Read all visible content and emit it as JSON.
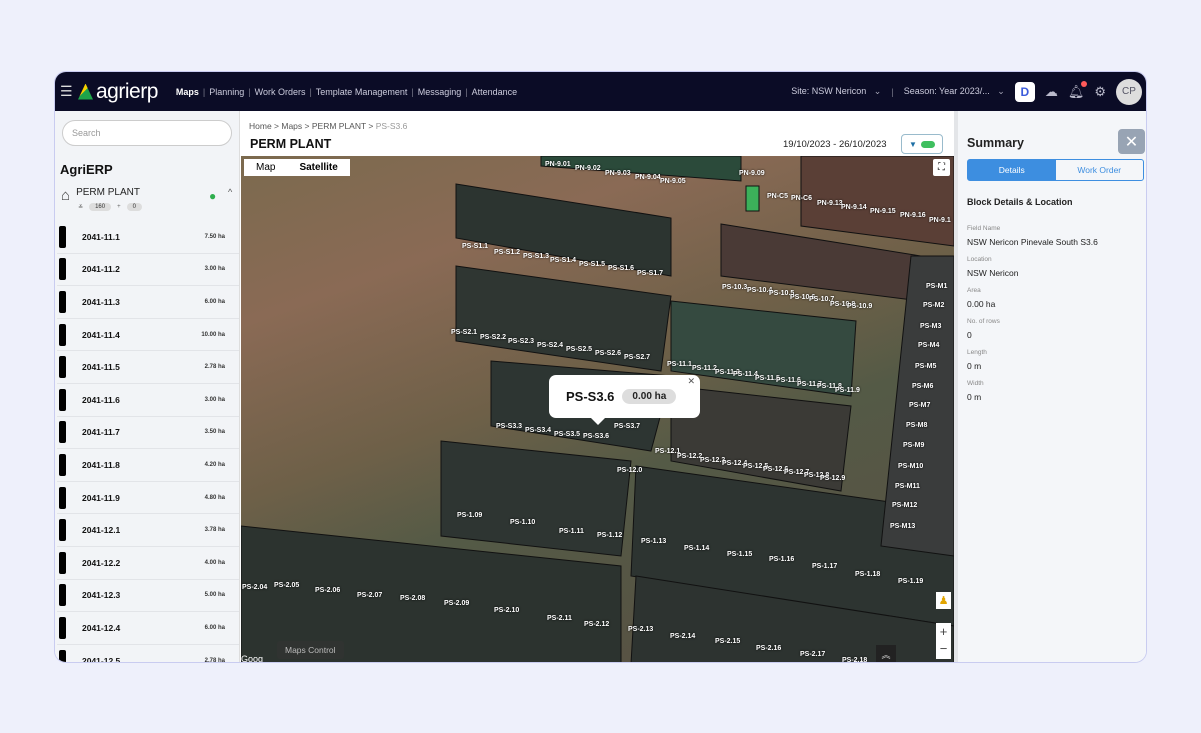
{
  "topbar": {
    "logo": "agrierp",
    "nav": [
      "Maps",
      "Planning",
      "Work Orders",
      "Template Management",
      "Messaging",
      "Attendance"
    ],
    "active": "Maps",
    "site": "Site: NSW Nericon",
    "season": "Season: Year 2023/...",
    "avatar": "CP"
  },
  "sidebar": {
    "search_placeholder": "Search",
    "org": "AgriERP",
    "farm": {
      "name": "PERM PLANT",
      "blocks": "160",
      "other": "0"
    },
    "items": [
      {
        "name": "2041-11.1",
        "area": "7.50 ha"
      },
      {
        "name": "2041-11.2",
        "area": "3.00 ha"
      },
      {
        "name": "2041-11.3",
        "area": "6.00 ha"
      },
      {
        "name": "2041-11.4",
        "area": "10.00 ha"
      },
      {
        "name": "2041-11.5",
        "area": "2.78 ha"
      },
      {
        "name": "2041-11.6",
        "area": "3.00 ha"
      },
      {
        "name": "2041-11.7",
        "area": "3.50 ha"
      },
      {
        "name": "2041-11.8",
        "area": "4.20 ha"
      },
      {
        "name": "2041-11.9",
        "area": "4.80 ha"
      },
      {
        "name": "2041-12.1",
        "area": "3.78 ha"
      },
      {
        "name": "2041-12.2",
        "area": "4.00 ha"
      },
      {
        "name": "2041-12.3",
        "area": "5.00 ha"
      },
      {
        "name": "2041-12.4",
        "area": "6.00 ha"
      },
      {
        "name": "2041-12.5",
        "area": "2.78 ha"
      }
    ]
  },
  "header": {
    "breadcrumb": [
      "Home",
      "Maps",
      "PERM PLANT",
      "PS-S3.6"
    ],
    "title": "PERM PLANT",
    "date_range": "19/10/2023 - 26/10/2023"
  },
  "map": {
    "types": [
      "Map",
      "Satellite"
    ],
    "active_type": "Satellite",
    "controls_label": "Maps Control",
    "attribution": "Goog",
    "popup": {
      "name": "PS-S3.6",
      "area": "0.00 ha"
    },
    "labels": [
      "PN-9.01",
      "PN-9.02",
      "PN-9.03",
      "PN-9.04",
      "PN-9.05",
      "PN-9.09",
      "PN-C5",
      "PN-C6",
      "PN-9.13",
      "PN-9.14",
      "PN-9.15",
      "PN-9.16",
      "PN-9.1",
      "PS-S1.1",
      "PS-S1.2",
      "PS-S1.3",
      "PS-S1.4",
      "PS-S1.5",
      "PS-S1.6",
      "PS-S1.7",
      "PS-S2.1",
      "PS-S2.2",
      "PS-S2.3",
      "PS-S2.4",
      "PS-S2.5",
      "PS-S2.6",
      "PS-S2.7",
      "PS-S3.3",
      "PS-S3.4",
      "PS-S3.5",
      "PS-S3.6",
      "PS-S3.7",
      "PS-10.3",
      "PS-10.4",
      "PS-10.5",
      "PS-10.6",
      "PS-10.7",
      "PS-10.8",
      "PS-10.9",
      "PS-11.1",
      "PS-11.2",
      "PS-11.3",
      "PS-11.4",
      "PS-11.5",
      "PS-11.6",
      "PS-11.7",
      "PS-11.8",
      "PS-11.9",
      "PS-M1",
      "PS-M2",
      "PS-M3",
      "PS-M4",
      "PS-M5",
      "PS-M6",
      "PS-M7",
      "PS-M8",
      "PS-M9",
      "PS-M10",
      "PS-M11",
      "PS-M12",
      "PS-M13",
      "PS-12.0",
      "PS-12.1",
      "PS-12.2",
      "PS-12.3",
      "PS-12.4",
      "PS-12.5",
      "PS-12.6",
      "PS-12.7",
      "PS-12.8",
      "PS-12.9",
      "PS-1.09",
      "PS-1.10",
      "PS-1.11",
      "PS-1.12",
      "PS-1.13",
      "PS-1.14",
      "PS-1.15",
      "PS-1.16",
      "PS-1.17",
      "PS-1.18",
      "PS-1.19",
      "PS-2.04",
      "PS-2.05",
      "PS-2.06",
      "PS-2.07",
      "PS-2.08",
      "PS-2.09",
      "PS-2.10",
      "PS-2.11",
      "PS-2.12",
      "PS-2.13",
      "PS-2.14",
      "PS-2.15",
      "PS-2.16",
      "PS-2.17",
      "PS-2.18"
    ]
  },
  "summary": {
    "title": "Summary",
    "tabs": [
      "Details",
      "Work Order"
    ],
    "section": "Block Details & Location",
    "fields": [
      {
        "label": "Field Name",
        "value": "NSW Nericon Pinevale South S3.6"
      },
      {
        "label": "Location",
        "value": "NSW Nericon"
      },
      {
        "label": "Area",
        "value": "0.00 ha"
      },
      {
        "label": "No. of rows",
        "value": "0"
      },
      {
        "label": "Length",
        "value": "0 m"
      },
      {
        "label": "Width",
        "value": "0 m"
      }
    ]
  },
  "colors": {
    "topbar": "#0b0c26",
    "accent": "#3d8ee0",
    "pin": "#2fae4e"
  }
}
